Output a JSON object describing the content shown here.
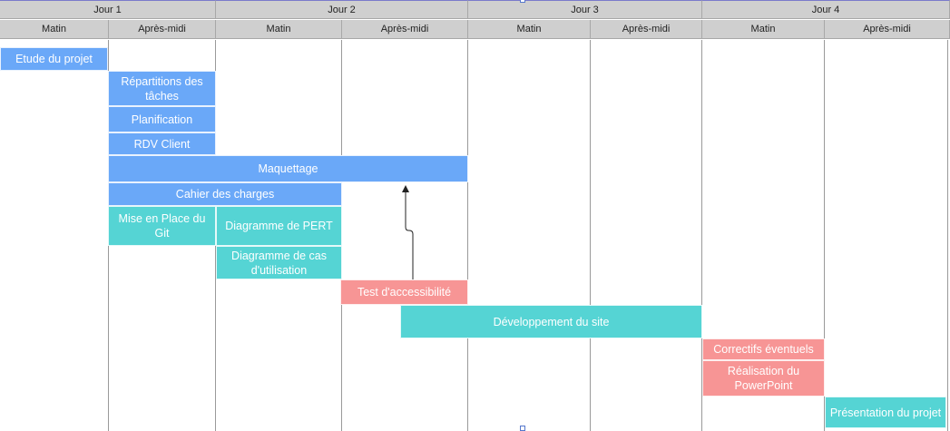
{
  "days": [
    {
      "label": "Jour 1",
      "halves": [
        "Matin",
        "Après-midi"
      ]
    },
    {
      "label": "Jour 2",
      "halves": [
        "Matin",
        "Après-midi"
      ]
    },
    {
      "label": "Jour 3",
      "halves": [
        "Matin",
        "Après-midi"
      ]
    },
    {
      "label": "Jour 4",
      "halves": [
        "Matin",
        "Après-midi"
      ]
    }
  ],
  "categories": {
    "planning": "#6aa8f8",
    "dev": "#55d4d4",
    "test": "#f79595"
  },
  "tasks": [
    {
      "label": "Etude du projet",
      "category": "planning"
    },
    {
      "label": "Répartitions des tâches",
      "category": "planning"
    },
    {
      "label": "Planification",
      "category": "planning"
    },
    {
      "label": "RDV Client",
      "category": "planning"
    },
    {
      "label": "Maquettage",
      "category": "planning"
    },
    {
      "label": "Cahier des charges",
      "category": "planning"
    },
    {
      "label": "Mise en Place du Git",
      "category": "dev"
    },
    {
      "label": "Diagramme de PERT",
      "category": "dev"
    },
    {
      "label": "Diagramme de cas d'utilisation",
      "category": "dev"
    },
    {
      "label": "Test d'accessibilité",
      "category": "test"
    },
    {
      "label": "Développement du site",
      "category": "dev"
    },
    {
      "label": "Correctifs éventuels",
      "category": "test"
    },
    {
      "label": "Réalisation du PowerPoint",
      "category": "test"
    },
    {
      "label": "Présentation du projet",
      "category": "dev"
    }
  ],
  "dependencies": [
    {
      "from": "Test d'accessibilité",
      "to": "Maquettage"
    }
  ]
}
